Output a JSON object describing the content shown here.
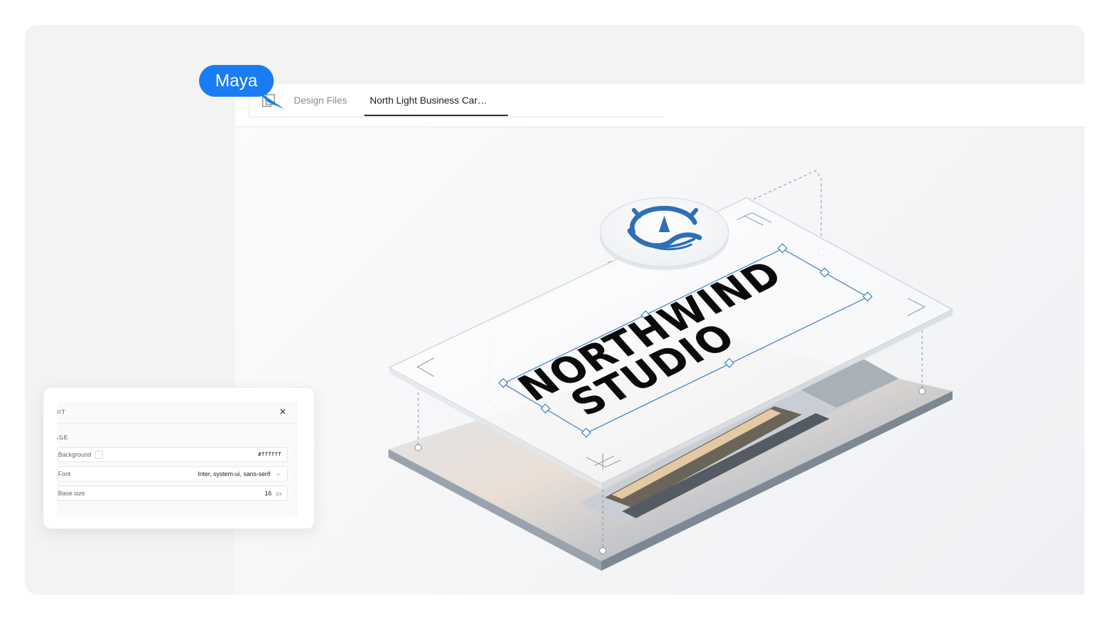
{
  "collaborator": {
    "name": "Maya",
    "color": "#1a7cf2"
  },
  "tabs": {
    "icon": "files-icon",
    "items": [
      {
        "label": "Design Files",
        "active": false
      },
      {
        "label": "North Light Business Car…",
        "active": true
      }
    ]
  },
  "artwork": {
    "logo_icon": "compass-wave-icon",
    "line1": "NORTHWIND",
    "line2": "STUDIO",
    "accent": "#2f6fb5"
  },
  "properties_panel": {
    "title": "DIT",
    "close_icon": "close-icon",
    "section": "AGE",
    "rows": [
      {
        "label": "Background",
        "value": "#ffffff",
        "swatch": "#ffffff"
      },
      {
        "label": "Font",
        "value": "Inter, system-ui, sans-serif",
        "control": "chevron-down-icon"
      },
      {
        "label": "Base size",
        "value": "16",
        "unit": "px"
      }
    ]
  }
}
